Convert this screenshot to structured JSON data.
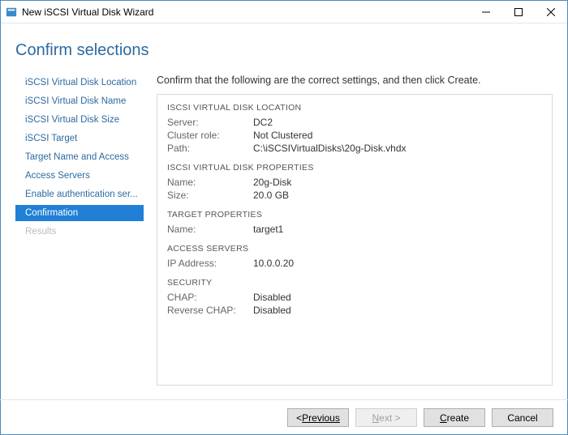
{
  "window": {
    "title": "New iSCSI Virtual Disk Wizard"
  },
  "heading": "Confirm selections",
  "sidebar": {
    "items": [
      {
        "label": "iSCSI Virtual Disk Location",
        "state": "normal"
      },
      {
        "label": "iSCSI Virtual Disk Name",
        "state": "normal"
      },
      {
        "label": "iSCSI Virtual Disk Size",
        "state": "normal"
      },
      {
        "label": "iSCSI Target",
        "state": "normal"
      },
      {
        "label": "Target Name and Access",
        "state": "normal"
      },
      {
        "label": "Access Servers",
        "state": "normal"
      },
      {
        "label": "Enable authentication ser...",
        "state": "normal"
      },
      {
        "label": "Confirmation",
        "state": "active"
      },
      {
        "label": "Results",
        "state": "disabled"
      }
    ]
  },
  "instruction": "Confirm that the following are the correct settings, and then click Create.",
  "sections": {
    "location": {
      "title": "ISCSI VIRTUAL DISK LOCATION",
      "server_label": "Server:",
      "server_value": "DC2",
      "cluster_label": "Cluster role:",
      "cluster_value": "Not Clustered",
      "path_label": "Path:",
      "path_value": "C:\\iSCSIVirtualDisks\\20g-Disk.vhdx"
    },
    "properties": {
      "title": "ISCSI VIRTUAL DISK PROPERTIES",
      "name_label": "Name:",
      "name_value": "20g-Disk",
      "size_label": "Size:",
      "size_value": "20.0 GB"
    },
    "target": {
      "title": "TARGET PROPERTIES",
      "name_label": "Name:",
      "name_value": "target1"
    },
    "access": {
      "title": "ACCESS SERVERS",
      "ip_label": "IP Address:",
      "ip_value": "10.0.0.20"
    },
    "security": {
      "title": "SECURITY",
      "chap_label": "CHAP:",
      "chap_value": "Disabled",
      "rchap_label": "Reverse CHAP:",
      "rchap_value": "Disabled"
    }
  },
  "buttons": {
    "previous": "Previous",
    "next": "Next >",
    "create": "Create",
    "cancel": "Cancel"
  }
}
